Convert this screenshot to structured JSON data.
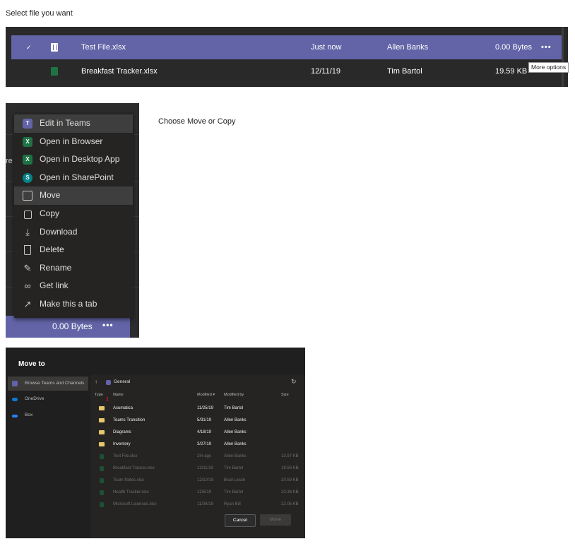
{
  "step1": {
    "caption": "Select file you want"
  },
  "file_list": {
    "rows": [
      {
        "name": "Test File.xlsx",
        "modified": "Just now",
        "modified_by": "Allen Banks",
        "size": "0.00 Bytes",
        "more": "•••"
      },
      {
        "name": "Breakfast Tracker.xlsx",
        "modified": "12/11/19",
        "modified_by": "Tim Bartol",
        "size": "19.59 KB"
      }
    ],
    "check_mark": "✓",
    "tooltip": "More options"
  },
  "step2": {
    "caption": "Choose Move or Copy"
  },
  "context_menu": {
    "left_fragment": "re",
    "items": [
      {
        "label": "Edit in Teams",
        "icon": "teams-icon"
      },
      {
        "label": "Open in Browser",
        "icon": "excel-icon"
      },
      {
        "label": "Open in Desktop App",
        "icon": "excel-icon"
      },
      {
        "label": "Open in SharePoint",
        "icon": "sharepoint-icon"
      },
      {
        "label": "Move",
        "icon": "move-icon"
      },
      {
        "label": "Copy",
        "icon": "copy-icon"
      },
      {
        "label": "Download",
        "icon": "download-icon"
      },
      {
        "label": "Delete",
        "icon": "trash-icon"
      },
      {
        "label": "Rename",
        "icon": "rename-icon"
      },
      {
        "label": "Get link",
        "icon": "link-icon"
      },
      {
        "label": "Make this a tab",
        "icon": "external-tab-icon"
      }
    ],
    "bottom_size": "0.00 Bytes",
    "bottom_more": "•••"
  },
  "dialog": {
    "title": "Move to",
    "sidebar": [
      {
        "label": "Browse Teams and Channels",
        "icon": "teams-icon"
      },
      {
        "label": "OneDrive",
        "icon": "onedrive-icon"
      },
      {
        "label": "Box",
        "icon": "box-icon"
      }
    ],
    "breadcrumb": "General",
    "columns": {
      "type": "Type",
      "name": "Name",
      "modified": "Modified ▾",
      "modified_by": "Modified by",
      "size": "Size"
    },
    "badge": "1",
    "folders": [
      {
        "name": "Acumatica",
        "modified": "11/25/19",
        "modified_by": "Tim Bartol"
      },
      {
        "name": "Teams Transition",
        "modified": "5/31/19",
        "modified_by": "Allen Banks"
      },
      {
        "name": "Diagrams",
        "modified": "4/18/19",
        "modified_by": "Allen Banks"
      },
      {
        "name": "Inventory",
        "modified": "3/27/19",
        "modified_by": "Allen Banks"
      }
    ],
    "files": [
      {
        "name": "Test File.xlsx",
        "modified": "2m ago",
        "modified_by": "Allen Banks",
        "size": "13.97 KB"
      },
      {
        "name": "Breakfast Tracker.xlsx",
        "modified": "12/11/19",
        "modified_by": "Tim Bartol",
        "size": "19.59 KB"
      },
      {
        "name": "Team Notes.xlsx",
        "modified": "12/10/19",
        "modified_by": "Brad Lesch",
        "size": "20.59 KB"
      },
      {
        "name": "Health Tracker.xlsx",
        "modified": "12/5/19",
        "modified_by": "Tim Bartol",
        "size": "20.38 KB"
      },
      {
        "name": "Microsoft Licenses.xlsx",
        "modified": "11/26/19",
        "modified_by": "Ryan Bill",
        "size": "22.05 KB"
      }
    ],
    "cancel": "Cancel",
    "move": "Move"
  },
  "colors": {
    "accent": "#6264a7",
    "excel": "#1f7244",
    "sharepoint": "#038387",
    "folder": "#e8c76a",
    "badge": "#e81123"
  }
}
